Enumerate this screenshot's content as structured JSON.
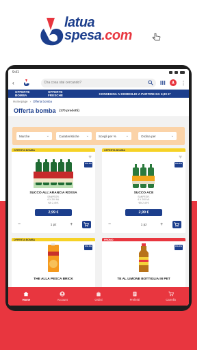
{
  "brand": {
    "logo_line1": "latua",
    "logo_line2": "spesa",
    "logo_domain": ".com",
    "color_primary": "#1c3e8c",
    "color_accent": "#e8363f"
  },
  "statusbar": {
    "time": "9:41"
  },
  "search": {
    "placeholder": "Cha cosa stai cercando?"
  },
  "nav": {
    "items": [
      "OFFERTE BOMBA",
      "OFFERTE FRESCHE",
      "CONSEGNA A DOMICILIO A PARTIRE DA 3,90 €*"
    ]
  },
  "breadcrumb": {
    "home": "Homepage",
    "separator": "›",
    "current": "Offerta bomba"
  },
  "page": {
    "title": "Offerta bomba",
    "count": "(170 prodotti)"
  },
  "filters": [
    {
      "label": "Marche"
    },
    {
      "label": "Caratteristiche"
    },
    {
      "label": "Scegli per % "
    },
    {
      "label": "Ordina per"
    }
  ],
  "products": [
    {
      "ribbon": "OFFERTA BOMBA",
      "iva_badge": "IVA 4%",
      "name": "SUCCO ALL'ARANCIA ROSSA",
      "brand": "SANPEGR.",
      "qty": "6 X 200 ML",
      "unit_price": "€/lt 2,49 €",
      "price": "2,99 €",
      "quantity": "1 pz"
    },
    {
      "ribbon": "OFFERTA BOMBA",
      "iva_badge": "IVA 4%",
      "name": "SUCCO ACE",
      "brand": "SANPEGR.",
      "qty": "6 X 200 ML",
      "unit_price": "€/lt 2,49 €",
      "price": "2,99 €",
      "quantity": "1 pz"
    },
    {
      "ribbon": "OFFERTA BOMBA",
      "iva_badge": "IVA 4%",
      "name": "THE ALLA PESCA BRICK"
    },
    {
      "ribbon": "PROMO",
      "iva_badge": "IVA 4%",
      "name": "TE AL LIMONE BOTTIGLIA IN PET"
    }
  ],
  "tabbar": [
    {
      "label": "Home",
      "icon": "home-icon",
      "active": true
    },
    {
      "label": "Account",
      "icon": "account-icon",
      "active": false
    },
    {
      "label": "Ordini",
      "icon": "orders-icon",
      "active": false
    },
    {
      "label": "Preferiti",
      "icon": "favorites-icon",
      "active": false
    },
    {
      "label": "Carrello",
      "icon": "cart-icon",
      "active": false
    }
  ]
}
